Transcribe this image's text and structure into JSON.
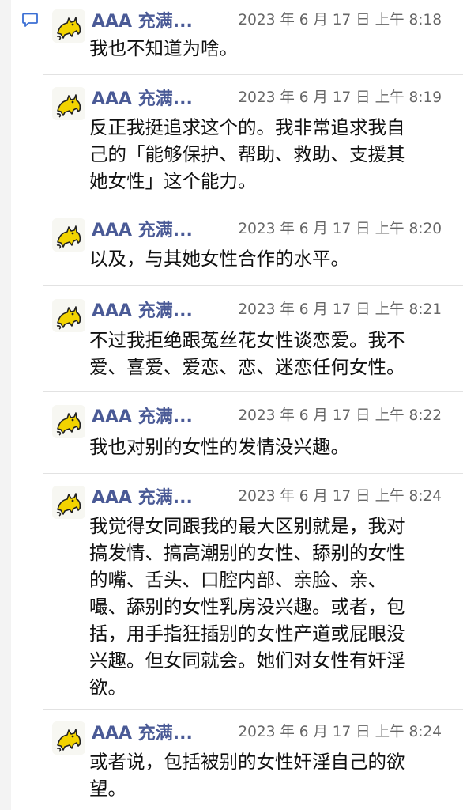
{
  "thread_icon": "comment-icon",
  "accent_color": "#4a5a96",
  "messages": [
    {
      "sender": "AAA 充满...",
      "time": "2023 年 6 月 17 日 上午 8:18",
      "lines": [
        "我也不知道为啥。"
      ],
      "avatar_icon": "cat-avatar"
    },
    {
      "sender": "AAA 充满...",
      "time": "2023 年 6 月 17 日 上午 8:19",
      "lines": [
        "反正我挺追求这个的。我非常追求我自",
        "己的「能够保护、帮助、救助、支援其",
        "她女性」这个能力。"
      ],
      "avatar_icon": "cat-avatar"
    },
    {
      "sender": "AAA 充满...",
      "time": "2023 年 6 月 17 日 上午 8:20",
      "lines": [
        "以及，与其她女性合作的水平。"
      ],
      "avatar_icon": "cat-avatar"
    },
    {
      "sender": "AAA 充满...",
      "time": "2023 年 6 月 17 日 上午 8:21",
      "lines": [
        "不过我拒绝跟菟丝花女性谈恋爱。我不",
        "爱、喜爱、爱恋、恋、迷恋任何女性。"
      ],
      "avatar_icon": "cat-avatar"
    },
    {
      "sender": "AAA 充满...",
      "time": "2023 年 6 月 17 日 上午 8:22",
      "lines": [
        "我也对别的女性的发情没兴趣。"
      ],
      "avatar_icon": "cat-avatar"
    },
    {
      "sender": "AAA 充满...",
      "time": "2023 年 6 月 17 日 上午 8:24",
      "lines": [
        "我觉得女同跟我的最大区别就是，我对",
        "搞发情、搞高潮别的女性、舔别的女性",
        "的嘴、舌头、口腔内部、亲脸、亲、",
        "嘬、舔别的女性乳房没兴趣。或者，包",
        "括，用手指狂插别的女性产道或屁眼没",
        "兴趣。但女同就会。她们对女性有奸淫",
        "欲。"
      ],
      "avatar_icon": "cat-avatar"
    },
    {
      "sender": "AAA 充满...",
      "time": "2023 年 6 月 17 日 上午 8:24",
      "lines": [
        "或者说，包括被别的女性奸淫自己的欲",
        "望。"
      ],
      "avatar_icon": "cat-avatar"
    }
  ]
}
